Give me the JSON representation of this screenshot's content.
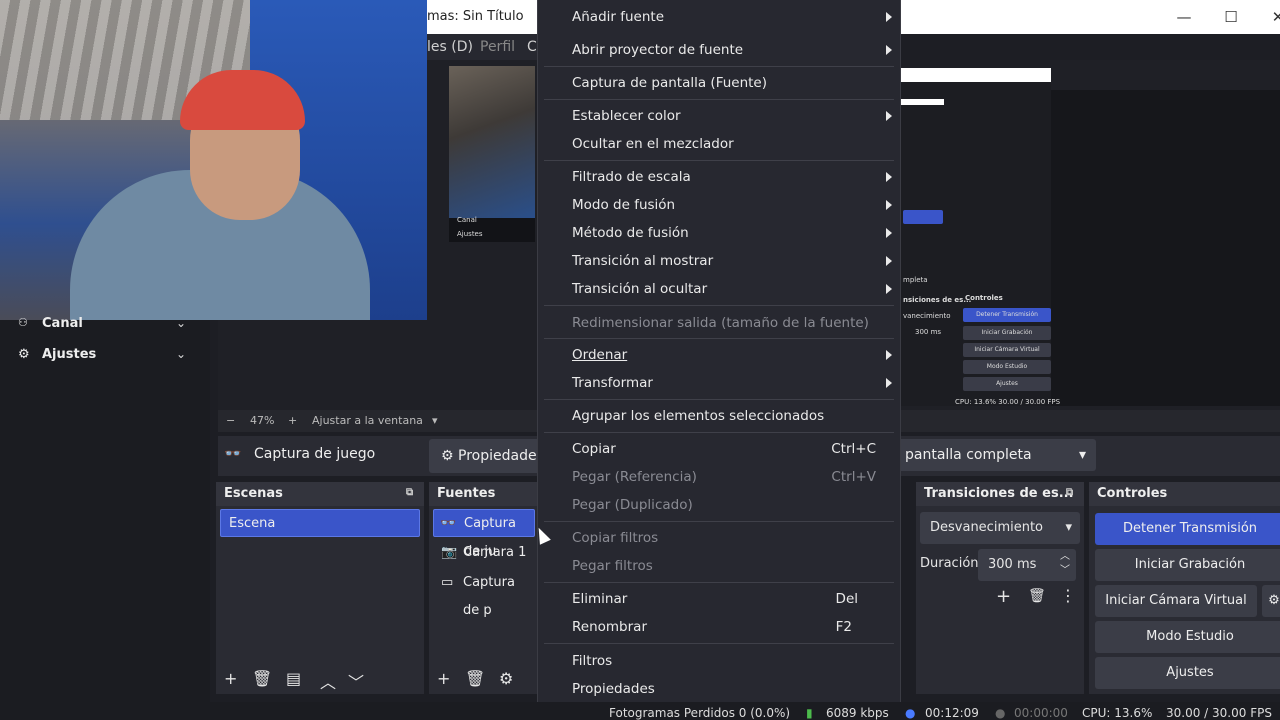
{
  "window": {
    "title": "mas: Sin Título",
    "minimize_glyph": "—",
    "maximize_glyph": "☐",
    "close_glyph": "✕"
  },
  "menubar": {
    "item_d": "les (D)",
    "item_perfil": "Perfil",
    "item_c": "C"
  },
  "preview_nested": {
    "canal": "Canal",
    "ajustes": "Ajustes",
    "controles": "Controles",
    "transiciones": "nsiciones de es...",
    "desvanecimiento": "vanecimiento",
    "duracion_value": "300 ms",
    "completa": "mpleta",
    "btn_detener": "Detener Transmisión",
    "btn_grabacion": "Iniciar Grabación",
    "btn_camara": "Iniciar Cámara Virtual",
    "btn_estudio": "Modo Estudio",
    "btn_ajustes": "Ajustes",
    "status": "CPU: 13.6%   30.00 / 30.00 FPS"
  },
  "sidebar": {
    "items": [
      {
        "label": "Canal"
      },
      {
        "label": "Ajustes"
      }
    ]
  },
  "zoombar": {
    "minus": "−",
    "zoom": "47%",
    "plus": "+",
    "fit": "Ajustar a la ventana",
    "caret": "▾"
  },
  "source_toolbar": {
    "source_icon": "gamepad-icon",
    "source_label": "Captura de juego",
    "properties_label": "Propiedades",
    "mode_value": "pantalla completa"
  },
  "docks": {
    "escenas": {
      "title": "Escenas",
      "items": [
        "Escena"
      ]
    },
    "fuentes": {
      "title": "Fuentes",
      "items": [
        "Captura de ju",
        "Camara 1",
        "Captura de p"
      ]
    },
    "transiciones": {
      "title": "Transiciones de es...",
      "type": "Desvanecimiento",
      "duracion_label": "Duración",
      "duracion_value": "300 ms"
    },
    "controles": {
      "title": "Controles",
      "buttons": [
        "Detener Transmisión",
        "Iniciar Grabación",
        "Iniciar Cámara Virtual",
        "Modo Estudio",
        "Ajustes"
      ]
    }
  },
  "statusbar": {
    "frames": "Fotogramas Perdidos 0 (0.0%)",
    "kbps": "6089 kbps",
    "stream_time": "00:12:09",
    "rec_time": "00:00:00",
    "cpu": "CPU: 13.6%",
    "fps": "30.00 / 30.00 FPS"
  },
  "context_menu": {
    "items": [
      {
        "label": "Añadir fuente",
        "submenu": true
      },
      {
        "label": "Abrir proyector de fuente",
        "submenu": true
      },
      {
        "label": "Captura de pantalla (Fuente)"
      },
      {
        "label": "Establecer color",
        "submenu": true
      },
      {
        "label": "Ocultar en el mezclador"
      },
      {
        "label": "Filtrado de escala",
        "submenu": true
      },
      {
        "label": "Modo de fusión",
        "submenu": true
      },
      {
        "label": "Método de fusión",
        "submenu": true
      },
      {
        "label": "Transición al mostrar",
        "submenu": true
      },
      {
        "label": "Transición al ocultar",
        "submenu": true
      },
      {
        "label": "Redimensionar salida (tamaño de la fuente)",
        "disabled": true
      },
      {
        "label": "Ordenar",
        "submenu": true
      },
      {
        "label": "Transformar",
        "submenu": true
      },
      {
        "label": "Agrupar los elementos seleccionados"
      },
      {
        "label": "Copiar",
        "shortcut": "Ctrl+C"
      },
      {
        "label": "Pegar (Referencia)",
        "shortcut": "Ctrl+V",
        "disabled": true
      },
      {
        "label": "Pegar (Duplicado)",
        "disabled": true
      },
      {
        "label": "Copiar filtros",
        "disabled": true
      },
      {
        "label": "Pegar filtros",
        "disabled": true
      },
      {
        "label": "Eliminar",
        "shortcut": "Del"
      },
      {
        "label": "Renombrar",
        "shortcut": "F2"
      },
      {
        "label": "Filtros"
      },
      {
        "label": "Propiedades"
      }
    ]
  },
  "colors": {
    "accent": "#3a55c9",
    "menu_bg": "#272830",
    "disabled": "#8a8b93"
  }
}
